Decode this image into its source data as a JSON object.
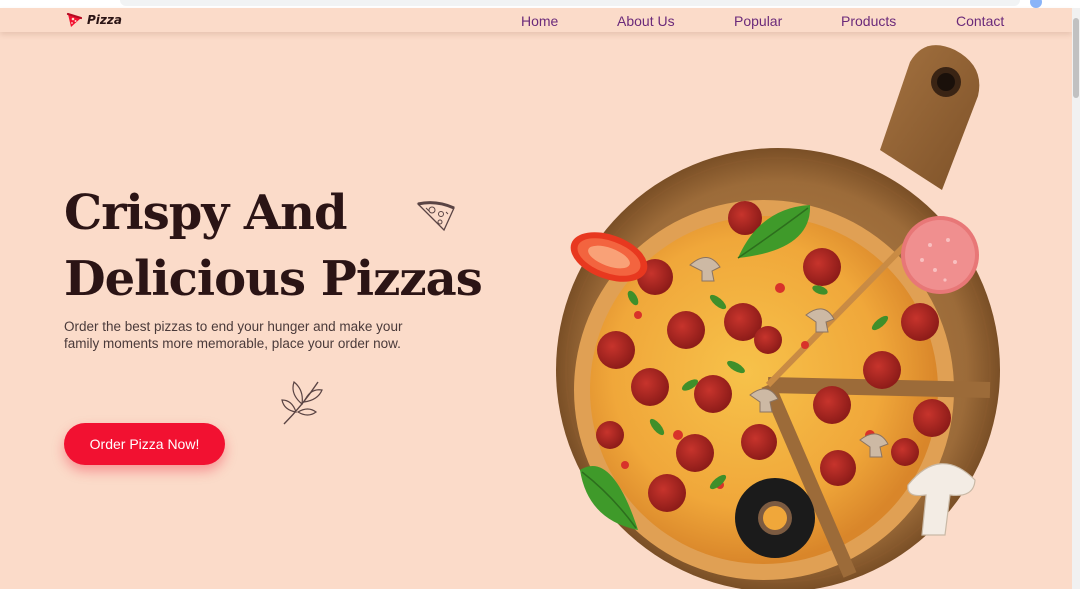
{
  "brand": {
    "name": "Pizza",
    "icon": "pizza-slice-icon",
    "accent_color": "#f21131"
  },
  "nav": {
    "items": [
      {
        "label": "Home",
        "name": "nav-home"
      },
      {
        "label": "About Us",
        "name": "nav-about-us"
      },
      {
        "label": "Popular",
        "name": "nav-popular"
      },
      {
        "label": "Products",
        "name": "nav-products"
      },
      {
        "label": "Contact",
        "name": "nav-contact"
      }
    ],
    "color": "#6b2a7a"
  },
  "hero": {
    "title_line1": "Crispy And",
    "title_line2": "Delicious Pizzas",
    "description": "Order the best pizzas to end your hunger and make your family moments more memorable, place your order now.",
    "cta_label": "Order Pizza Now!",
    "background_color": "#fbdbc9"
  },
  "decorations": {
    "doodle_1": "pizza-slice-doodle-icon",
    "doodle_2": "leaf-doodle-icon",
    "main_image": "pizza-on-wooden-board-image"
  }
}
